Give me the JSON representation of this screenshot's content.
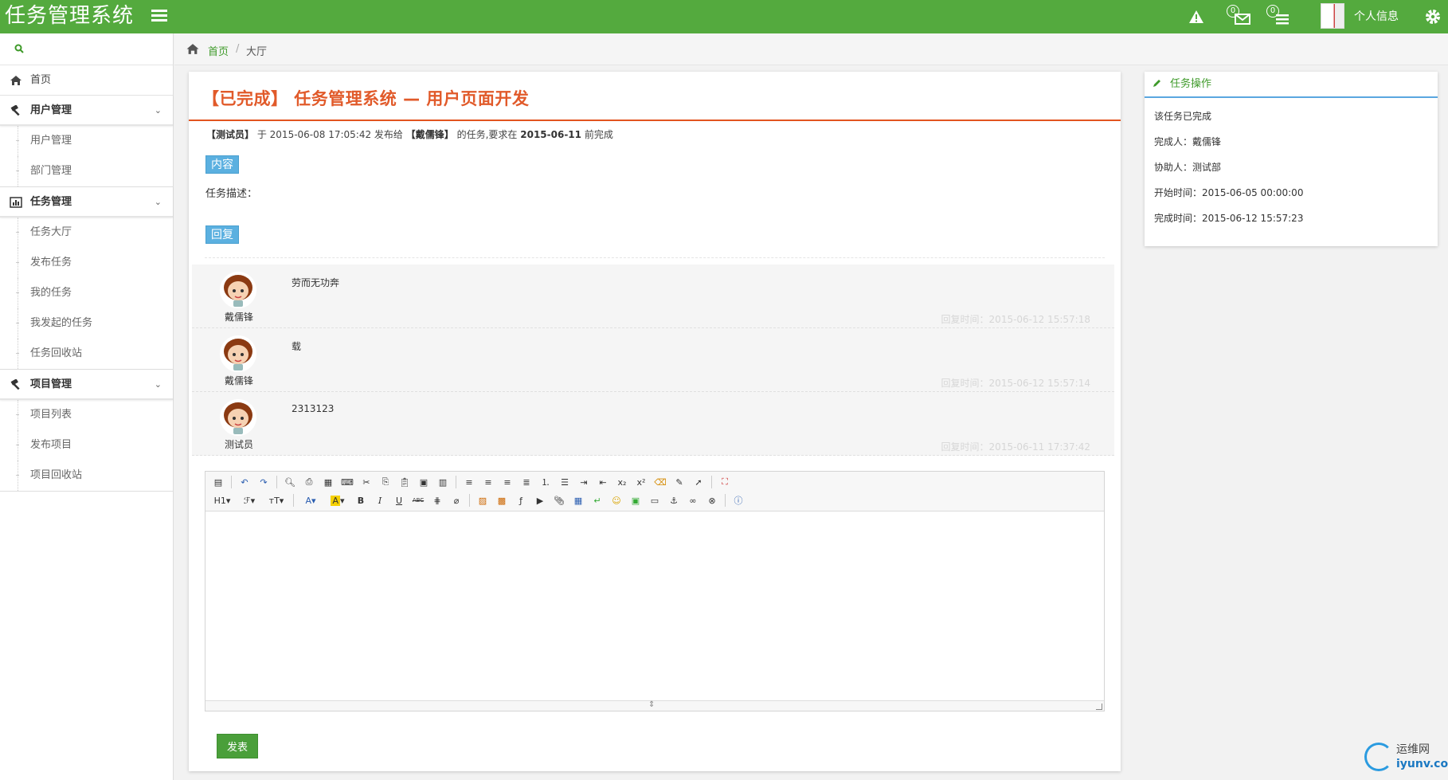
{
  "header": {
    "brand": "任务管理系统",
    "alert_count": "0",
    "message_count": "0",
    "user_label": "个人信息"
  },
  "sidebar": {
    "items": [
      {
        "label": "首页",
        "type": "item",
        "icon": "home-icon"
      },
      {
        "label": "用户管理",
        "type": "group",
        "icon": "hammer-icon",
        "children": [
          "用户管理",
          "部门管理"
        ]
      },
      {
        "label": "任务管理",
        "type": "group",
        "icon": "chart-icon",
        "children": [
          "任务大厅",
          "发布任务",
          "我的任务",
          "我发起的任务",
          "任务回收站"
        ]
      },
      {
        "label": "项目管理",
        "type": "group",
        "icon": "hammer-icon",
        "children": [
          "项目列表",
          "发布项目",
          "项目回收站"
        ]
      }
    ]
  },
  "breadcrumb": {
    "home": "首页",
    "separator": "/",
    "current": "大厅"
  },
  "task": {
    "title": "【已完成】 任务管理系统 — 用户页面开发",
    "publisher": "【测试员】",
    "at": "于 2015-06-08 17:05:42 发布给",
    "assignee": "【戴儒锋】",
    "mid": "的任务,要求在",
    "deadline": "2015-06-11",
    "tail": "前完成",
    "content_tag": "内容",
    "description": "任务描述：",
    "reply_tag": "回复"
  },
  "replies": [
    {
      "name": "戴儒锋",
      "text": "劳而无功奔",
      "time": "回复时间：2015-06-12 15:57:18"
    },
    {
      "name": "戴儒锋",
      "text": "载",
      "time": "回复时间：2015-06-12 15:57:14"
    },
    {
      "name": "测试员",
      "text": "2313123",
      "time": "回复时间：2015-06-11 17:37:42"
    }
  ],
  "editor": {
    "row2_labels": {
      "heading": "H1",
      "font": "ℱ",
      "size": "тT",
      "color": "A",
      "bg": "A",
      "bold": "B",
      "italic": "I",
      "underline": "U",
      "strike": "ABC"
    }
  },
  "submit_label": "发表",
  "panel": {
    "title": "任务操作",
    "status": "该任务已完成",
    "finisher": "完成人：戴儒锋",
    "helper": "协助人：测试部",
    "start": "开始时间：2015-06-05 00:00:00",
    "finish": "完成时间：2015-06-12 15:57:23"
  },
  "watermark": {
    "cn": "运维网",
    "en": "iyunv.com"
  },
  "colors": {
    "header_green": "#54aa3e",
    "title_orange": "#e15a2a",
    "tag_blue": "#5bb0e0",
    "button_green": "#4a9f3a"
  }
}
